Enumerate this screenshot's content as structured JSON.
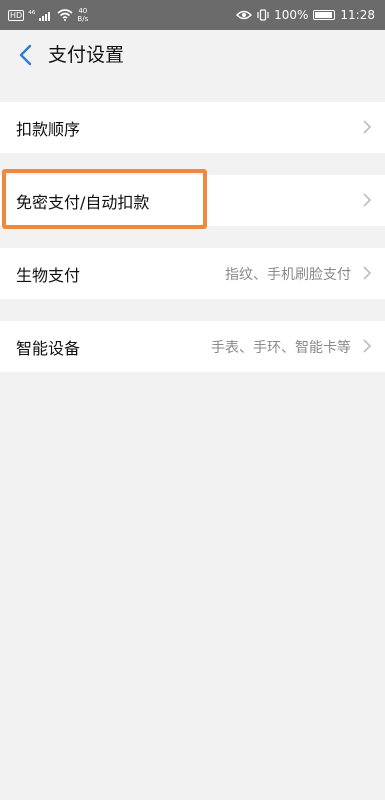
{
  "statusbar": {
    "hd": "HD",
    "network_type": "⁴⁶",
    "speed_value": "40",
    "speed_unit": "B/s",
    "battery": "100%",
    "time": "11:28"
  },
  "header": {
    "title": "支付设置"
  },
  "items": [
    {
      "label": "扣款顺序",
      "sub": ""
    },
    {
      "label": "免密支付/自动扣款",
      "sub": ""
    },
    {
      "label": "生物支付",
      "sub": "指纹、手机刷脸支付"
    },
    {
      "label": "智能设备",
      "sub": "手表、手环、智能卡等"
    }
  ],
  "colors": {
    "highlight": "#ef8a3c",
    "accent_back": "#2f7bd6",
    "statusbar": "#6b6b6b"
  }
}
